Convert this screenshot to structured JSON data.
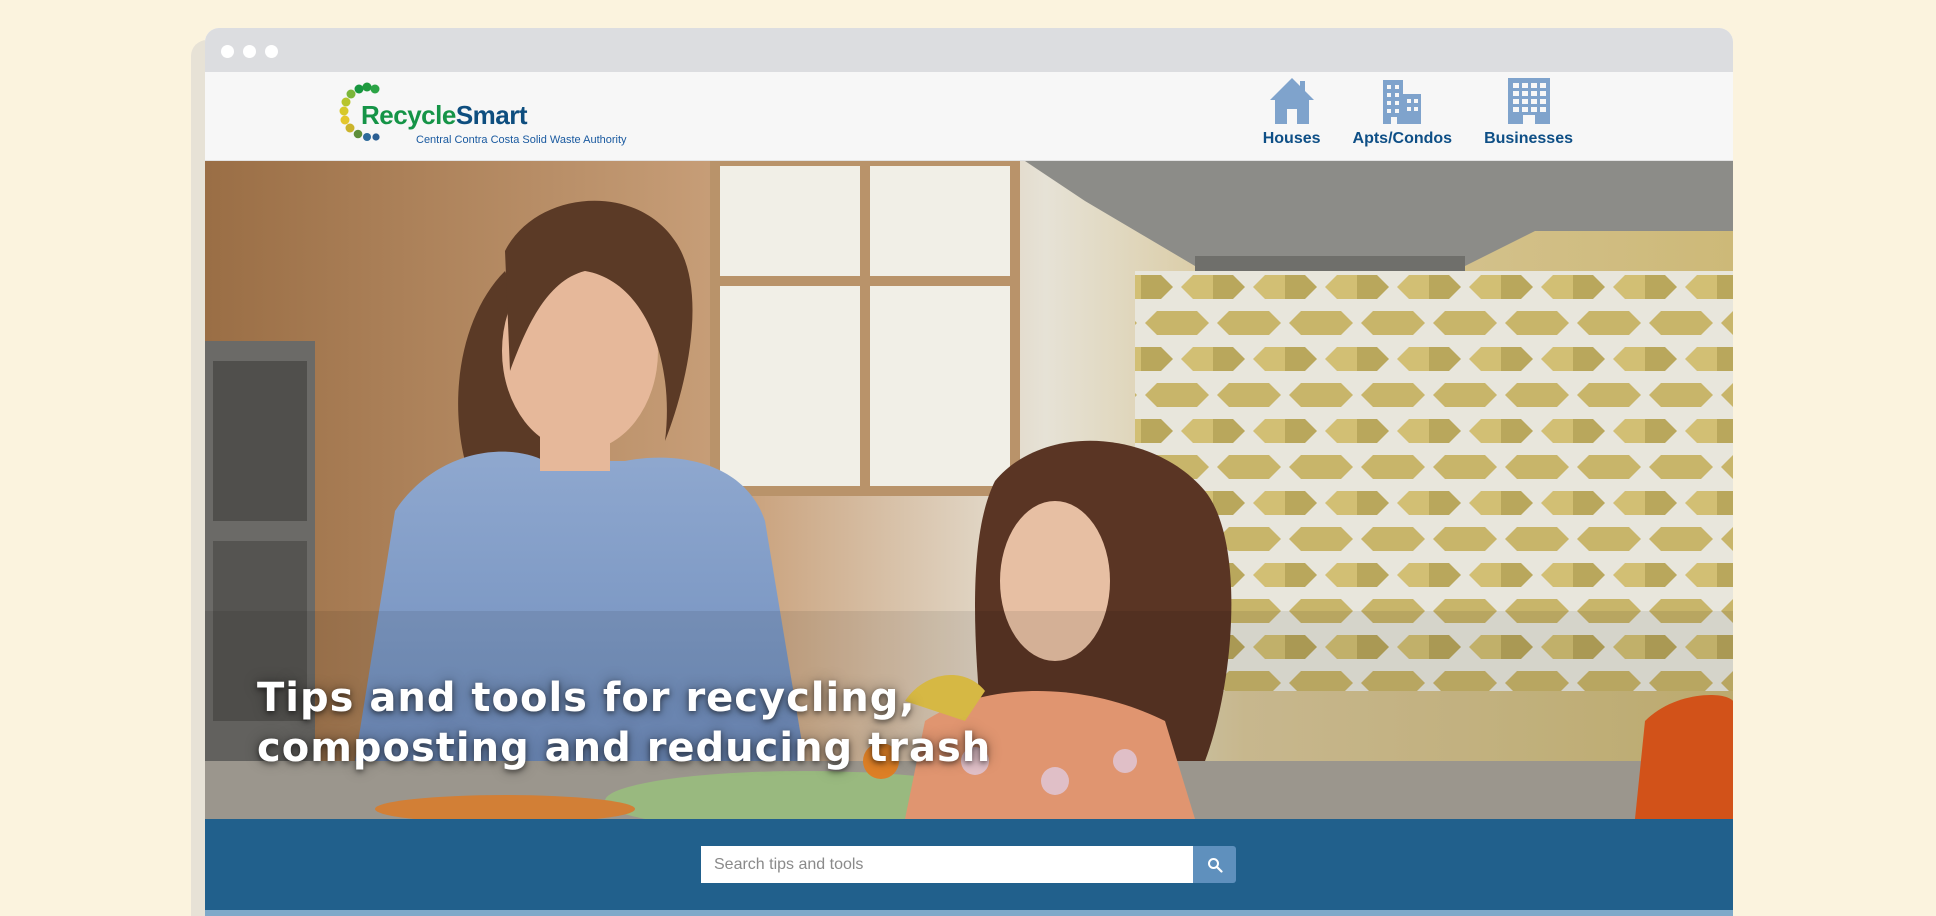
{
  "logo": {
    "name_part1": "Recycle",
    "name_part2": "Smart",
    "subtitle": "Central Contra Costa Solid Waste Authority"
  },
  "nav": {
    "items": [
      {
        "label": "Houses",
        "icon": "house-icon"
      },
      {
        "label": "Apts/Condos",
        "icon": "apartment-building-icon"
      },
      {
        "label": "Businesses",
        "icon": "office-building-icon"
      }
    ]
  },
  "hero": {
    "title_line1": "Tips and tools for recycling,",
    "title_line2": "composting and reducing trash"
  },
  "search": {
    "placeholder": "Search tips and tools",
    "value": "",
    "button_icon": "search-icon"
  },
  "colors": {
    "page_background": "#fbf3de",
    "brand_green": "#159447",
    "brand_blue": "#0e4f86",
    "nav_icon": "#7fa3cc",
    "search_band": "#0e5382",
    "search_button": "#5f90bd"
  }
}
